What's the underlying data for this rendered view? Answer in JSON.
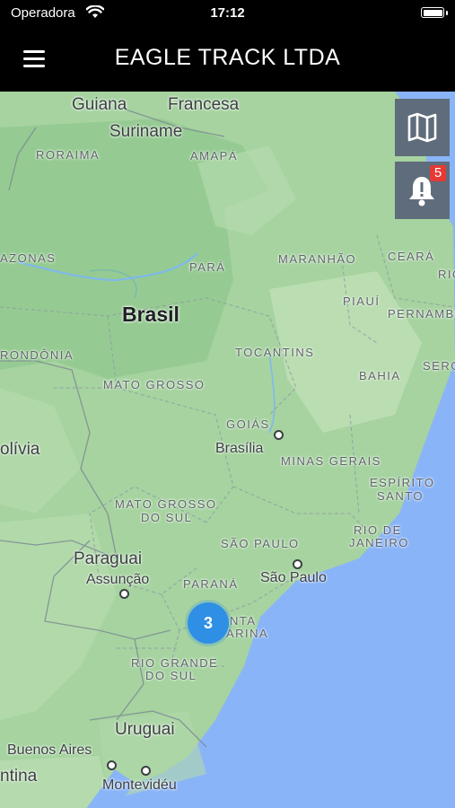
{
  "status_bar": {
    "carrier": "Operadora",
    "time": "17:12"
  },
  "header": {
    "title": "EAGLE TRACK LTDA",
    "menu_icon": "hamburger-menu-icon"
  },
  "map": {
    "labels": {
      "guiana": "Guiana",
      "francesa": "Francesa",
      "suriname": "Suriname",
      "roraima": "RORAIMA",
      "amapa": "AMAPÁ",
      "amazonas": "AZONAS",
      "para": "PARÁ",
      "maranhao": "MARANHÃO",
      "ceara": "CEARÁ",
      "rio_grande_norte": "RIO",
      "brasil": "Brasil",
      "piaui": "PIAUÍ",
      "pernambuco": "PERNAMBU",
      "rondonia": "RONDÔNIA",
      "tocantins": "TOCANTINS",
      "bahia": "BAHIA",
      "sergipe": "SERG",
      "mato_grosso": "MATO GROSSO",
      "goias": "GOIÁS",
      "brasilia": "Brasília",
      "bolivia": "olívia",
      "minas_gerais": "MINAS GERAIS",
      "espirito_santo_1": "ESPÍRITO",
      "espirito_santo_2": "SANTO",
      "mato_grosso_sul_1": "MATO GROSSO",
      "mato_grosso_sul_2": "DO SUL",
      "rio_janeiro_1": "RIO DE",
      "rio_janeiro_2": "JANEIRO",
      "sao_paulo_state": "SÃO PAULO",
      "paraguai": "Paraguai",
      "assuncao": "Assunção",
      "parana": "PARANÁ",
      "sao_paulo_city": "São Paulo",
      "santa_catarina_1": "NTA",
      "santa_catarina_2": "ARINA",
      "rio_grande_sul_1": "RIO GRANDE",
      "rio_grande_sul_2": "DO SUL",
      "uruguai": "Uruguai",
      "buenos_aires": "Buenos Aires",
      "argentina": "ntina",
      "montevideu": "Montevidéu"
    },
    "controls": {
      "map_type_icon": "map-icon",
      "alerts_icon": "bell-icon",
      "alerts_count": "5"
    },
    "cluster": {
      "count": "3"
    }
  }
}
